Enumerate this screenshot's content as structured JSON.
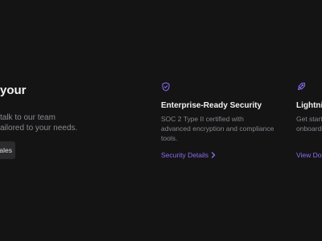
{
  "left": {
    "heading": "your",
    "desc_line1": "talk to our team",
    "desc_line2": "ailored to your needs.",
    "button_label": "ales"
  },
  "features": [
    {
      "icon": "shield-check-icon",
      "title": "Enterprise-Ready Security",
      "desc_line1": "SOC 2 Type II certified with",
      "desc_line2": "advanced encryption and compliance",
      "desc_line3": "tools.",
      "link_label": "Security Details"
    },
    {
      "icon": "rocket-icon",
      "title": "Lightnin",
      "desc_line1": "Get starte",
      "desc_line2": "onboardi",
      "link_label": "View Doc"
    }
  ],
  "colors": {
    "background": "#141414",
    "accent": "#8a6cf0",
    "muted_text": "#84848c"
  }
}
